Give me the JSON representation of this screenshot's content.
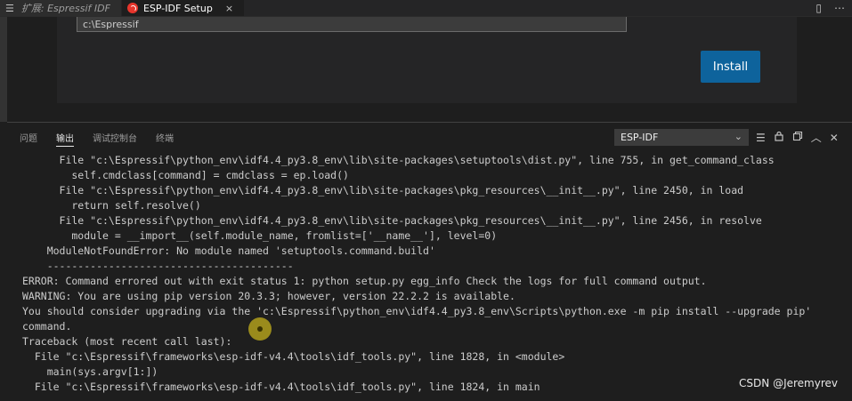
{
  "tabs": [
    {
      "label": "扩展: Espressif IDF",
      "icon": "menu-icon"
    },
    {
      "label": "ESP-IDF Setup",
      "icon": "espressif-logo-icon",
      "close": "×"
    }
  ],
  "tab_actions": {
    "split": "▯",
    "more": "⋯"
  },
  "setup": {
    "path_value": "c:\\Espressif",
    "install_label": "Install"
  },
  "panel": {
    "tabs": [
      "问题",
      "输出",
      "调试控制台",
      "终端"
    ],
    "active_tab": "输出",
    "channel": "ESP-IDF",
    "icons": [
      "list-filter-icon",
      "lock-icon",
      "copy-icon",
      "chevron-up-icon",
      "close-icon"
    ]
  },
  "output_lines": [
    "      File \"c:\\Espressif\\python_env\\idf4.4_py3.8_env\\lib\\site-packages\\setuptools\\dist.py\", line 755, in get_command_class",
    "        self.cmdclass[command] = cmdclass = ep.load()",
    "      File \"c:\\Espressif\\python_env\\idf4.4_py3.8_env\\lib\\site-packages\\pkg_resources\\__init__.py\", line 2450, in load",
    "        return self.resolve()",
    "      File \"c:\\Espressif\\python_env\\idf4.4_py3.8_env\\lib\\site-packages\\pkg_resources\\__init__.py\", line 2456, in resolve",
    "        module = __import__(self.module_name, fromlist=['__name__'], level=0)",
    "    ModuleNotFoundError: No module named 'setuptools.command.build'",
    "    ----------------------------------------",
    "ERROR: Command errored out with exit status 1: python setup.py egg_info Check the logs for full command output.",
    "WARNING: You are using pip version 20.3.3; however, version 22.2.2 is available.",
    "You should consider upgrading via the 'c:\\Espressif\\python_env\\idf4.4_py3.8_env\\Scripts\\python.exe -m pip install --upgrade pip'",
    "command.",
    "Traceback (most recent call last):",
    "  File \"c:\\Espressif\\frameworks\\esp-idf-v4.4\\tools\\idf_tools.py\", line 1828, in <module>",
    "    main(sys.argv[1:])",
    "  File \"c:\\Espressif\\frameworks\\esp-idf-v4.4\\tools\\idf_tools.py\", line 1824, in main"
  ],
  "watermark": "CSDN @Jeremyrev"
}
